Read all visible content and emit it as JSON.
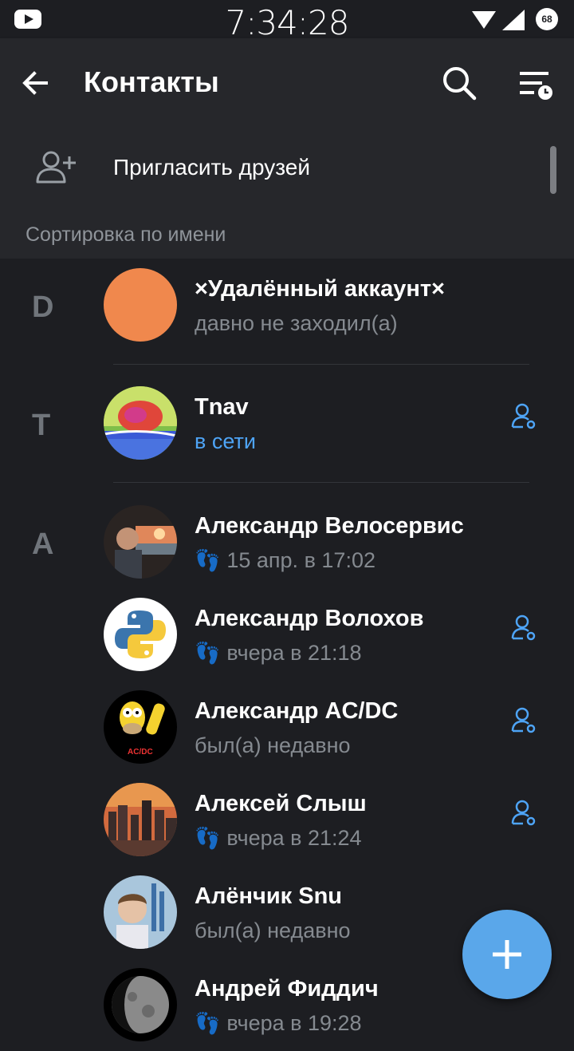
{
  "statusbar": {
    "time": "7:34:28",
    "battery": "68"
  },
  "appbar": {
    "title": "Контакты"
  },
  "invite": {
    "label": "Пригласить друзей"
  },
  "section": {
    "label": "Сортировка по имени"
  },
  "contacts": [
    {
      "letter": "D",
      "name": "×Удалённый аккаунт×",
      "status": "давно не заходил(а)"
    },
    {
      "letter": "T",
      "name": "Tnav",
      "status": "в сети"
    },
    {
      "letter": "A",
      "name": "Александр Велосервис",
      "status": "15 апр. в 17:02"
    },
    {
      "letter": "",
      "name": "Александр Волохов",
      "status": "вчера в 21:18"
    },
    {
      "letter": "",
      "name": "Александр AC/DC",
      "status": "был(а) недавно"
    },
    {
      "letter": "",
      "name": "Алексей Слыш",
      "status": "вчера в 21:24"
    },
    {
      "letter": "",
      "name": "Алёнчик Snu",
      "status": "был(а) недавно"
    },
    {
      "letter": "",
      "name": "Андрей Фиддич",
      "status": "вчера в 19:28"
    }
  ],
  "colors": {
    "background": "#1d1e22",
    "bar": "#26272b",
    "accent": "#5aa7ea",
    "online": "#4ea4f6",
    "deleted_avatar": "#f0884d"
  },
  "icons": [
    "back-arrow-icon",
    "search-icon",
    "sort-icon",
    "add-user-icon",
    "mutual-contact-icon",
    "footprint-icon",
    "plus-icon"
  ]
}
